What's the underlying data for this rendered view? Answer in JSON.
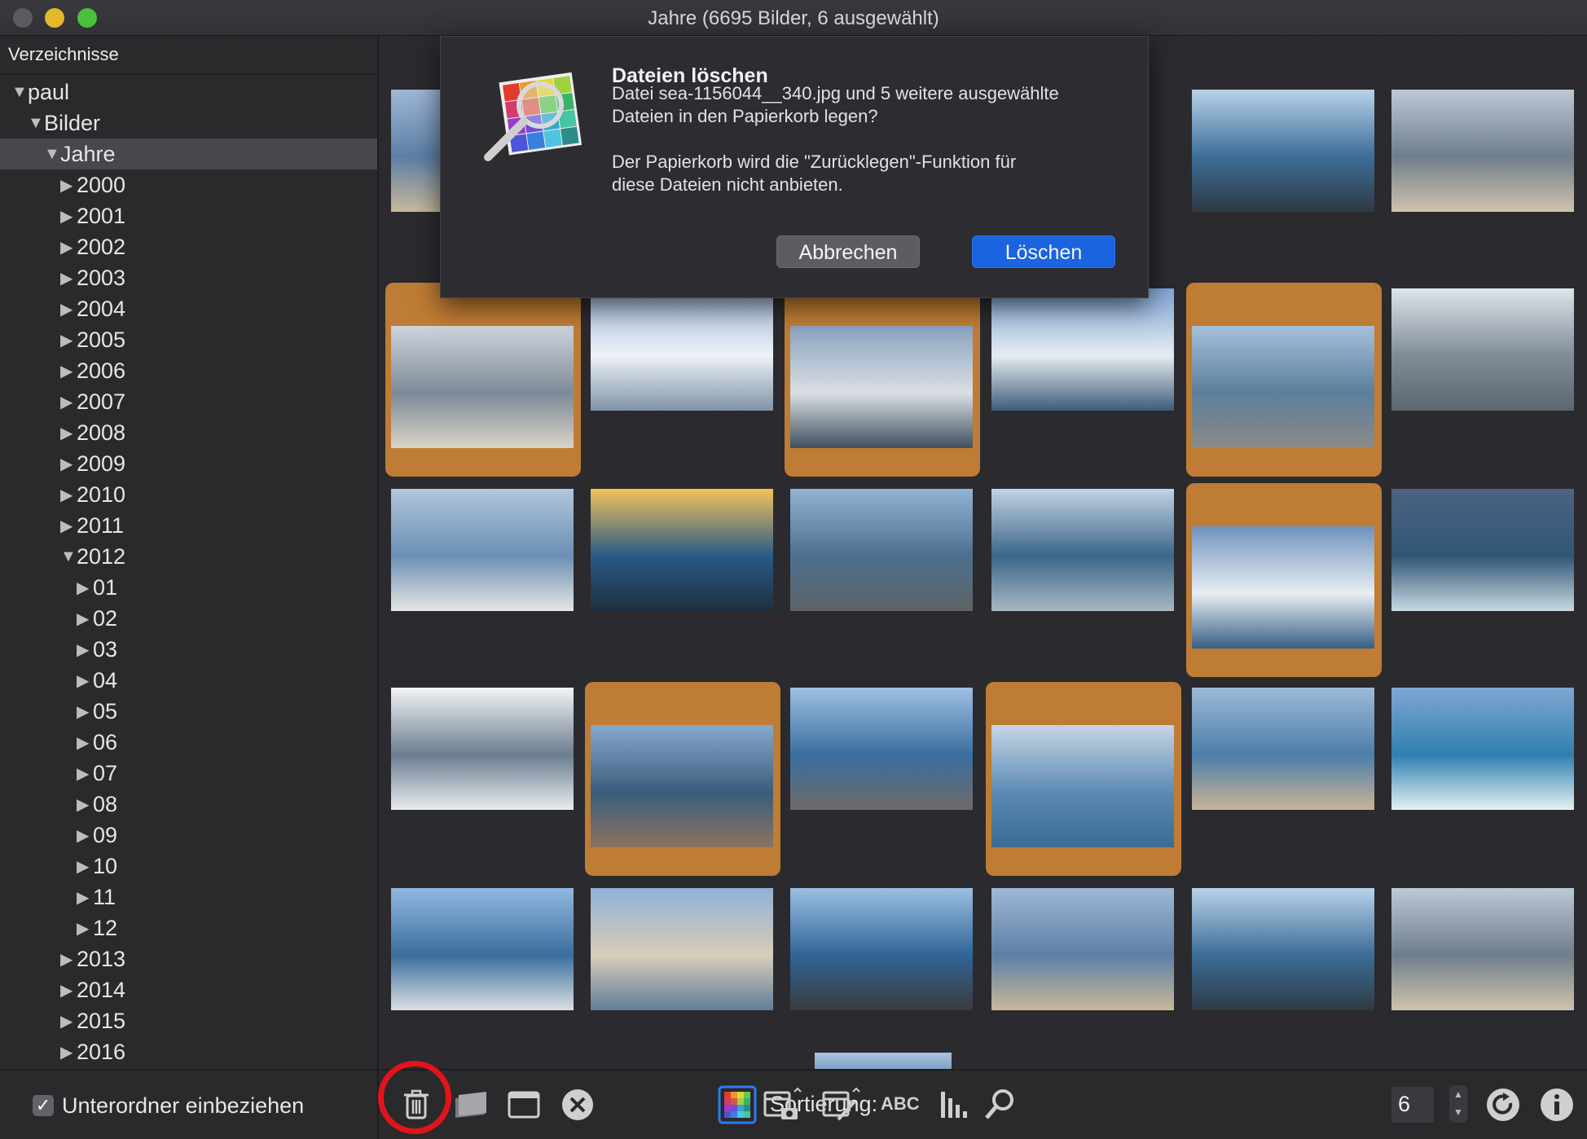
{
  "window": {
    "title": "Jahre (6695 Bilder, 6 ausgewählt)"
  },
  "sidebar": {
    "header": "Verzeichnisse",
    "tree": [
      {
        "label": "paul",
        "expanded": true
      },
      {
        "label": "Bilder",
        "expanded": true
      },
      {
        "label": "Jahre",
        "expanded": true,
        "selected": true
      },
      {
        "label": "2000"
      },
      {
        "label": "2001"
      },
      {
        "label": "2002"
      },
      {
        "label": "2003"
      },
      {
        "label": "2004"
      },
      {
        "label": "2005"
      },
      {
        "label": "2006"
      },
      {
        "label": "2007"
      },
      {
        "label": "2008"
      },
      {
        "label": "2009"
      },
      {
        "label": "2010"
      },
      {
        "label": "2011"
      },
      {
        "label": "2012",
        "expanded": true
      },
      {
        "label": "01"
      },
      {
        "label": "02"
      },
      {
        "label": "03"
      },
      {
        "label": "04"
      },
      {
        "label": "05"
      },
      {
        "label": "06"
      },
      {
        "label": "07"
      },
      {
        "label": "08"
      },
      {
        "label": "09"
      },
      {
        "label": "10"
      },
      {
        "label": "11"
      },
      {
        "label": "12"
      },
      {
        "label": "2013"
      },
      {
        "label": "2014"
      },
      {
        "label": "2015"
      },
      {
        "label": "2016"
      }
    ],
    "include_subfolders_label": "Unterordner einbeziehen",
    "include_subfolders_checked": true
  },
  "dialog": {
    "title": "Dateien löschen",
    "message_line1": "Datei sea-1156044__340.jpg und 5 weitere ausgewählte",
    "message_line2": "Dateien in den Papierkorb legen?",
    "message_line3": "Der Papierkorb wird die \"Zurücklegen\"-Funktion für",
    "message_line4": "diese Dateien nicht anbieten.",
    "cancel_label": "Abbrechen",
    "delete_label": "Löschen"
  },
  "toolbar": {
    "sort_label": "Sortierung:",
    "abc_label": "ABC",
    "thumbnail_count": "6",
    "icons": [
      "trash-icon",
      "folder-icon",
      "window-icon",
      "close-circle-icon",
      "color-grid-icon",
      "calendar-camera-icon",
      "calendar-edit-icon",
      "abc-sort-icon",
      "histogram-icon",
      "search-icon",
      "refresh-icon",
      "info-icon"
    ]
  },
  "colors": {
    "selection": "#bf7c34",
    "accent": "#1a64e0",
    "highlight_ring": "#e2141b"
  },
  "thumbnails": [
    {
      "row": 1,
      "col": 1,
      "selected": false
    },
    {
      "row": 1,
      "col": 5,
      "selected": false
    },
    {
      "row": 1,
      "col": 6,
      "selected": false
    },
    {
      "row": 2,
      "col": 1,
      "selected": true
    },
    {
      "row": 2,
      "col": 2,
      "selected": false
    },
    {
      "row": 2,
      "col": 3,
      "selected": true
    },
    {
      "row": 2,
      "col": 4,
      "selected": false
    },
    {
      "row": 2,
      "col": 5,
      "selected": true
    },
    {
      "row": 2,
      "col": 6,
      "selected": false
    },
    {
      "row": 3,
      "col": 1,
      "selected": false
    },
    {
      "row": 3,
      "col": 2,
      "selected": false
    },
    {
      "row": 3,
      "col": 3,
      "selected": false
    },
    {
      "row": 3,
      "col": 4,
      "selected": false
    },
    {
      "row": 3,
      "col": 5,
      "selected": true
    },
    {
      "row": 3,
      "col": 6,
      "selected": false
    },
    {
      "row": 4,
      "col": 1,
      "selected": false
    },
    {
      "row": 4,
      "col": 2,
      "selected": true
    },
    {
      "row": 4,
      "col": 3,
      "selected": false
    },
    {
      "row": 4,
      "col": 4,
      "selected": true
    },
    {
      "row": 4,
      "col": 5,
      "selected": false
    },
    {
      "row": 4,
      "col": 6,
      "selected": false
    },
    {
      "row": 5,
      "col": 1,
      "selected": false
    },
    {
      "row": 5,
      "col": 2,
      "selected": false
    },
    {
      "row": 5,
      "col": 3,
      "selected": false
    },
    {
      "row": 5,
      "col": 4,
      "selected": false
    },
    {
      "row": 5,
      "col": 5,
      "selected": false
    },
    {
      "row": 5,
      "col": 6,
      "selected": false
    }
  ]
}
